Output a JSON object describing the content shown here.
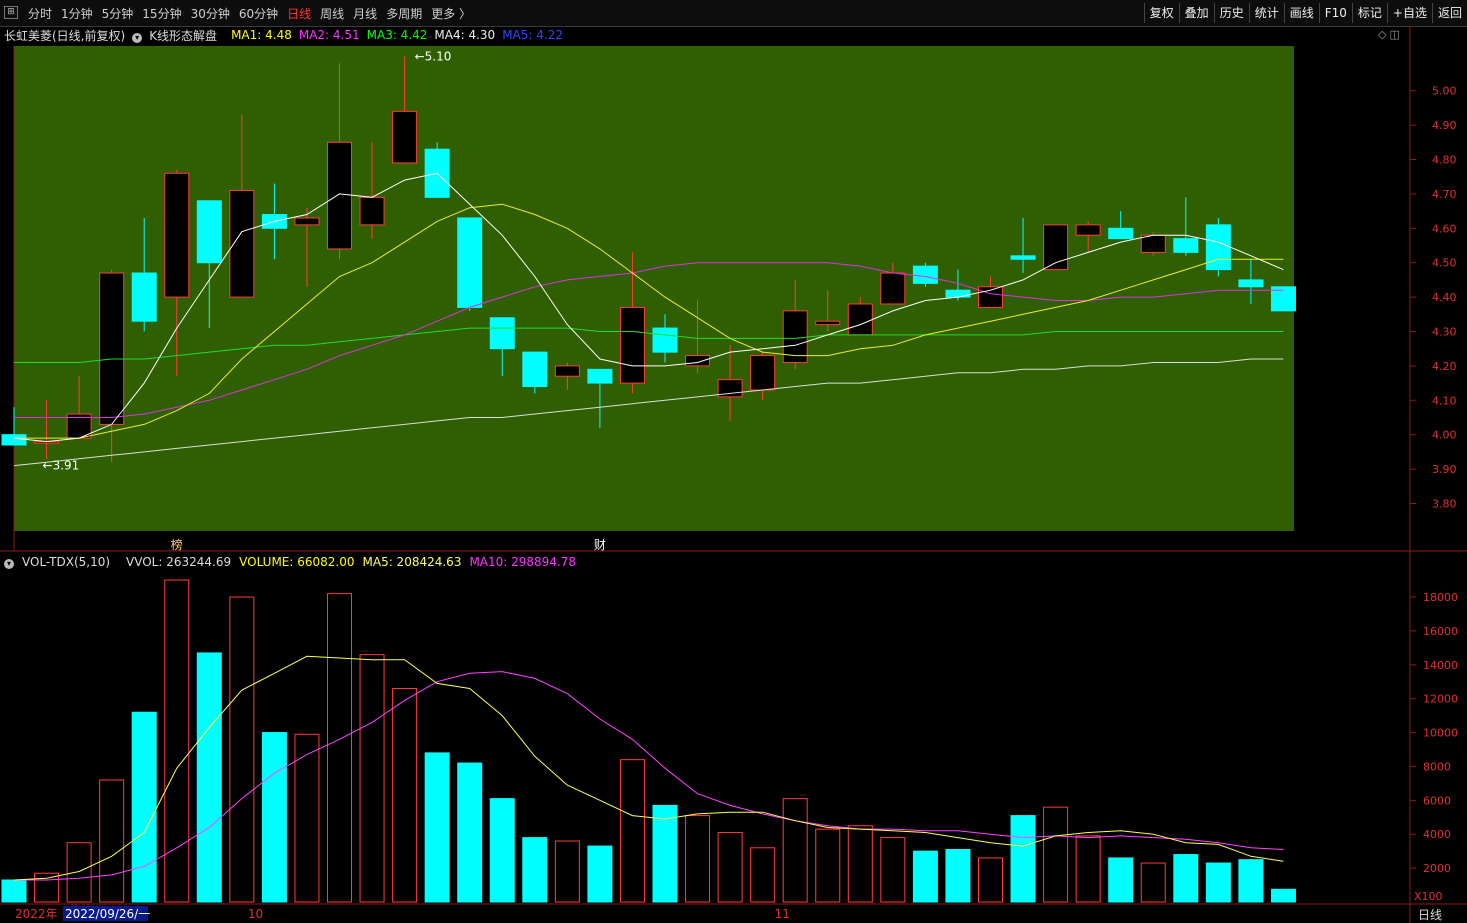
{
  "toolbar": {
    "periods": [
      "分时",
      "1分钟",
      "5分钟",
      "15分钟",
      "30分钟",
      "60分钟",
      "日线",
      "周线",
      "月线",
      "多周期",
      "更多 〉"
    ],
    "active_period": "日线",
    "tools": [
      "复权",
      "叠加",
      "历史",
      "统计",
      "画线",
      "F10",
      "标记",
      "+自选",
      "返回"
    ]
  },
  "info": {
    "stock": "长虹美菱(日线,前复权)",
    "pattern": "K线形态解盘",
    "ma1": "MA1: 4.48",
    "ma2": "MA2: 4.51",
    "ma3": "MA3: 4.42",
    "ma4": "MA4: 4.30",
    "ma5": "MA5: 4.22"
  },
  "vol_info": {
    "title": "VOL-TDX(5,10)",
    "vvol": "VVOL: 263244.69",
    "volume": "VOLUME: 66082.00",
    "ma5": "MA5: 208424.63",
    "ma10": "MA10: 298894.78"
  },
  "period_label": "日线",
  "colors": {
    "up": "#ff3d3d",
    "down": "#00ffff",
    "price_bg": "#2f5f00",
    "ma1": "#ffff00",
    "ma2": "#ff00ff",
    "ma3": "#00ff00",
    "ma4": "#ffffff",
    "ma5": "#0000ff"
  },
  "chart_data": {
    "type": "candlestick",
    "price_axis": {
      "ticks": [
        3.8,
        3.9,
        4.0,
        4.1,
        4.2,
        4.3,
        4.4,
        4.5,
        4.6,
        4.7,
        4.8,
        4.9,
        5.0
      ],
      "ylim": [
        3.72,
        5.13
      ]
    },
    "volume_axis": {
      "ticks": [
        2000,
        4000,
        6000,
        8000,
        10000,
        12000,
        14000,
        16000,
        18000
      ],
      "ylim": [
        0,
        19300
      ],
      "multiplier": "X100"
    },
    "high_marker": "5.10",
    "low_marker": "3.91",
    "markers": [
      "榜",
      "财"
    ],
    "date_labels": [
      {
        "text": "2022年",
        "index": 0
      },
      {
        "text": "2022/09/26/一",
        "index": 2
      },
      {
        "text": "10",
        "index": 7
      },
      {
        "text": "11",
        "index": 23
      }
    ],
    "candles": [
      {
        "o": 4.0,
        "h": 4.08,
        "l": 3.99,
        "c": 3.97,
        "v": 1300
      },
      {
        "o": 3.98,
        "h": 4.1,
        "l": 3.93,
        "c": 3.98,
        "v": 1700
      },
      {
        "o": 3.99,
        "h": 4.17,
        "l": 3.99,
        "c": 4.06,
        "v": 3500
      },
      {
        "o": 4.03,
        "h": 4.48,
        "l": 3.92,
        "c": 4.47,
        "v": 7200
      },
      {
        "o": 4.47,
        "h": 4.63,
        "l": 4.3,
        "c": 4.33,
        "v": 11200
      },
      {
        "o": 4.4,
        "h": 4.77,
        "l": 4.17,
        "c": 4.76,
        "v": 19000
      },
      {
        "o": 4.68,
        "h": 4.68,
        "l": 4.31,
        "c": 4.5,
        "v": 14700
      },
      {
        "o": 4.4,
        "h": 4.93,
        "l": 4.4,
        "c": 4.71,
        "v": 18000
      },
      {
        "o": 4.64,
        "h": 4.73,
        "l": 4.51,
        "c": 4.6,
        "v": 10000
      },
      {
        "o": 4.61,
        "h": 4.66,
        "l": 4.43,
        "c": 4.63,
        "v": 9900
      },
      {
        "o": 4.54,
        "h": 5.08,
        "l": 4.51,
        "c": 4.85,
        "v": 18200
      },
      {
        "o": 4.61,
        "h": 4.85,
        "l": 4.57,
        "c": 4.69,
        "v": 14600
      },
      {
        "o": 4.79,
        "h": 5.1,
        "l": 4.79,
        "c": 4.94,
        "v": 12600
      },
      {
        "o": 4.83,
        "h": 4.85,
        "l": 4.69,
        "c": 4.69,
        "v": 8800
      },
      {
        "o": 4.63,
        "h": 4.63,
        "l": 4.36,
        "c": 4.37,
        "v": 8200
      },
      {
        "o": 4.34,
        "h": 4.34,
        "l": 4.17,
        "c": 4.25,
        "v": 6100
      },
      {
        "o": 4.24,
        "h": 4.24,
        "l": 4.12,
        "c": 4.14,
        "v": 3800
      },
      {
        "o": 4.17,
        "h": 4.21,
        "l": 4.13,
        "c": 4.2,
        "v": 3600
      },
      {
        "o": 4.19,
        "h": 4.19,
        "l": 4.02,
        "c": 4.15,
        "v": 3300
      },
      {
        "o": 4.15,
        "h": 4.53,
        "l": 4.12,
        "c": 4.37,
        "v": 8400
      },
      {
        "o": 4.31,
        "h": 4.35,
        "l": 4.21,
        "c": 4.24,
        "v": 5700
      },
      {
        "o": 4.2,
        "h": 4.39,
        "l": 4.18,
        "c": 4.23,
        "v": 5100
      },
      {
        "o": 4.11,
        "h": 4.26,
        "l": 4.04,
        "c": 4.16,
        "v": 4100
      },
      {
        "o": 4.13,
        "h": 4.24,
        "l": 4.1,
        "c": 4.23,
        "v": 3200
      },
      {
        "o": 4.21,
        "h": 4.45,
        "l": 4.19,
        "c": 4.36,
        "v": 6100
      },
      {
        "o": 4.32,
        "h": 4.42,
        "l": 4.3,
        "c": 4.33,
        "v": 4300
      },
      {
        "o": 4.29,
        "h": 4.4,
        "l": 4.29,
        "c": 4.38,
        "v": 4500
      },
      {
        "o": 4.38,
        "h": 4.5,
        "l": 4.38,
        "c": 4.47,
        "v": 3800
      },
      {
        "o": 4.49,
        "h": 4.5,
        "l": 4.43,
        "c": 4.44,
        "v": 3000
      },
      {
        "o": 4.42,
        "h": 4.48,
        "l": 4.39,
        "c": 4.4,
        "v": 3100
      },
      {
        "o": 4.37,
        "h": 4.46,
        "l": 4.37,
        "c": 4.43,
        "v": 2600
      },
      {
        "o": 4.52,
        "h": 4.63,
        "l": 4.47,
        "c": 4.51,
        "v": 5100
      },
      {
        "o": 4.48,
        "h": 4.61,
        "l": 4.48,
        "c": 4.61,
        "v": 5600
      },
      {
        "o": 4.58,
        "h": 4.62,
        "l": 4.53,
        "c": 4.61,
        "v": 3900
      },
      {
        "o": 4.6,
        "h": 4.65,
        "l": 4.57,
        "c": 4.57,
        "v": 2600
      },
      {
        "o": 4.53,
        "h": 4.59,
        "l": 4.52,
        "c": 4.58,
        "v": 2300
      },
      {
        "o": 4.57,
        "h": 4.69,
        "l": 4.52,
        "c": 4.53,
        "v": 2800
      },
      {
        "o": 4.61,
        "h": 4.63,
        "l": 4.46,
        "c": 4.48,
        "v": 2300
      },
      {
        "o": 4.45,
        "h": 4.51,
        "l": 4.38,
        "c": 4.43,
        "v": 2500
      },
      {
        "o": 4.43,
        "h": 4.43,
        "l": 4.36,
        "c": 4.36,
        "v": 750
      }
    ],
    "ma_price": {
      "ma1": [
        3.99,
        3.98,
        3.99,
        4.03,
        4.15,
        4.31,
        4.45,
        4.59,
        4.62,
        4.64,
        4.7,
        4.69,
        4.74,
        4.76,
        4.67,
        4.58,
        4.46,
        4.32,
        4.22,
        4.2,
        4.2,
        4.21,
        4.24,
        4.25,
        4.26,
        4.29,
        4.32,
        4.36,
        4.39,
        4.4,
        4.42,
        4.45,
        4.5,
        4.53,
        4.56,
        4.58,
        4.58,
        4.56,
        4.52,
        4.48
      ],
      "ma2": [
        3.99,
        3.99,
        3.99,
        4.01,
        4.03,
        4.07,
        4.12,
        4.22,
        4.3,
        4.38,
        4.46,
        4.5,
        4.56,
        4.62,
        4.66,
        4.67,
        4.64,
        4.6,
        4.54,
        4.47,
        4.4,
        4.34,
        4.28,
        4.24,
        4.23,
        4.23,
        4.25,
        4.26,
        4.29,
        4.31,
        4.33,
        4.35,
        4.37,
        4.39,
        4.42,
        4.45,
        4.48,
        4.51,
        4.51,
        4.51
      ],
      "ma3": [
        4.05,
        4.05,
        4.05,
        4.05,
        4.06,
        4.08,
        4.1,
        4.13,
        4.16,
        4.19,
        4.23,
        4.26,
        4.29,
        4.33,
        4.37,
        4.4,
        4.43,
        4.45,
        4.46,
        4.47,
        4.49,
        4.5,
        4.5,
        4.5,
        4.5,
        4.5,
        4.49,
        4.47,
        4.46,
        4.44,
        4.41,
        4.4,
        4.39,
        4.39,
        4.4,
        4.4,
        4.41,
        4.42,
        4.42,
        4.42
      ],
      "ma4": [
        4.21,
        4.21,
        4.21,
        4.22,
        4.22,
        4.23,
        4.24,
        4.25,
        4.26,
        4.26,
        4.27,
        4.28,
        4.29,
        4.3,
        4.31,
        4.31,
        4.31,
        4.31,
        4.3,
        4.3,
        4.29,
        4.28,
        4.28,
        4.28,
        4.28,
        4.29,
        4.29,
        4.29,
        4.29,
        4.29,
        4.29,
        4.29,
        4.3,
        4.3,
        4.3,
        4.3,
        4.3,
        4.3,
        4.3,
        4.3
      ],
      "ma5": [
        3.91,
        3.92,
        3.93,
        3.94,
        3.95,
        3.96,
        3.97,
        3.98,
        3.99,
        4.0,
        4.01,
        4.02,
        4.03,
        4.04,
        4.05,
        4.05,
        4.06,
        4.07,
        4.08,
        4.09,
        4.1,
        4.11,
        4.12,
        4.13,
        4.14,
        4.15,
        4.15,
        4.16,
        4.17,
        4.18,
        4.18,
        4.19,
        4.19,
        4.2,
        4.2,
        4.21,
        4.21,
        4.21,
        4.22,
        4.22
      ]
    },
    "ma_volume": {
      "ma5": [
        1300,
        1400,
        1800,
        2700,
        4100,
        7900,
        10300,
        12500,
        13500,
        14500,
        14400,
        14300,
        14300,
        12900,
        12600,
        11000,
        8600,
        6900,
        6000,
        5100,
        4900,
        5200,
        5300,
        5300,
        4800,
        4400,
        4300,
        4200,
        4100,
        3800,
        3500,
        3300,
        3900,
        4100,
        4200,
        4000,
        3500,
        3400,
        2700,
        2400
      ],
      "ma10": [
        1300,
        1300,
        1400,
        1600,
        2100,
        3200,
        4400,
        6100,
        7600,
        8700,
        9600,
        10600,
        11900,
        13000,
        13500,
        13600,
        13200,
        12300,
        10800,
        9600,
        7900,
        6400,
        5700,
        5200,
        4800,
        4500,
        4300,
        4300,
        4200,
        4200,
        4000,
        3800,
        3900,
        3800,
        3900,
        3800,
        3700,
        3500,
        3200,
        3100
      ]
    }
  }
}
